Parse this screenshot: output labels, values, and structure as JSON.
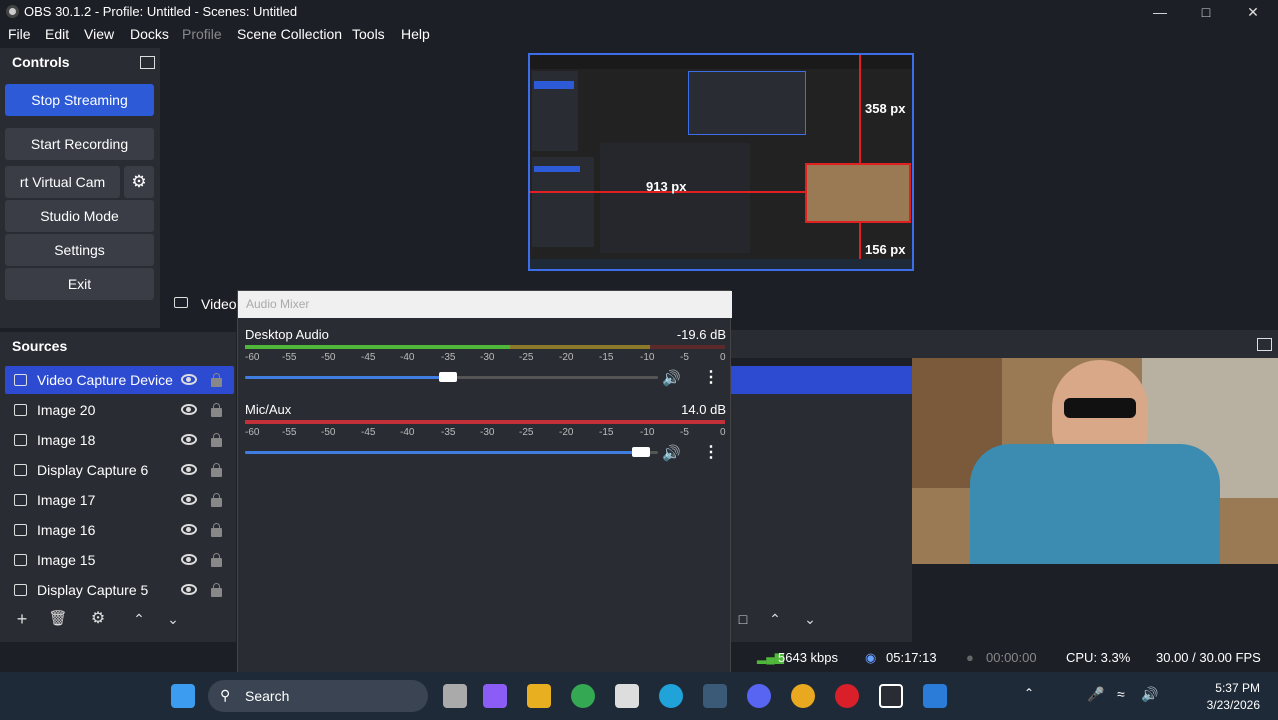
{
  "window": {
    "title": "OBS 30.1.2 - Profile: Untitled - Scenes: Untitled"
  },
  "menu": [
    "File",
    "Edit",
    "View",
    "Docks",
    "Profile",
    "Scene Collection",
    "Tools",
    "Help"
  ],
  "controls": {
    "header": "Controls",
    "stop_streaming": "Stop Streaming",
    "start_recording": "Start Recording",
    "virtual_cam": "rt Virtual Cam",
    "studio_mode": "Studio Mode",
    "settings": "Settings",
    "exit": "Exit"
  },
  "preview": {
    "label_top": "358 px",
    "label_mid": "913 px",
    "label_bottom": "156 px",
    "source_label": "Video"
  },
  "sources": {
    "header": "Sources",
    "items": [
      {
        "name": "Video Capture Device",
        "selected": true,
        "icon": "camera-icon"
      },
      {
        "name": "Image 20",
        "icon": "image-icon"
      },
      {
        "name": "Image 18",
        "icon": "image-icon"
      },
      {
        "name": "Display Capture 6",
        "icon": "monitor-icon"
      },
      {
        "name": "Image 17",
        "icon": "image-icon"
      },
      {
        "name": "Image 16",
        "icon": "image-icon"
      },
      {
        "name": "Image 15",
        "icon": "image-icon"
      },
      {
        "name": "Display Capture 5",
        "icon": "monitor-icon"
      }
    ]
  },
  "mixer": {
    "title": "Audio Mixer",
    "ticks": [
      "-60",
      "-55",
      "-50",
      "-45",
      "-40",
      "-35",
      "-30",
      "-25",
      "-20",
      "-15",
      "-10",
      "-5",
      "0"
    ],
    "channels": [
      {
        "name": "Desktop Audio",
        "db": "-19.6 dB",
        "volume": 0.49
      },
      {
        "name": "Mic/Aux",
        "db": "14.0 dB",
        "volume": 0.98
      }
    ]
  },
  "status": {
    "bitrate": "5643 kbps",
    "stream_time": "05:17:13",
    "rec_time": "00:00:00",
    "cpu": "CPU: 3.3%",
    "fps": "30.00 / 30.00 FPS"
  },
  "taskbar": {
    "search_placeholder": "Search",
    "time": "5:37 PM",
    "date": "3/23/2026"
  },
  "colors": {
    "accent": "#2d5bd8",
    "bg": "#1d1f26",
    "panel": "#2a2c33",
    "green": "#4fb83a",
    "red": "#c4303a"
  }
}
